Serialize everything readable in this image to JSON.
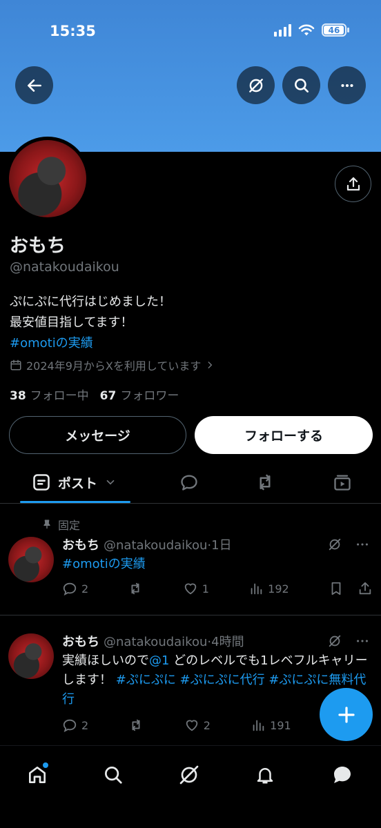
{
  "status_bar": {
    "time": "15:35",
    "battery": "46"
  },
  "header": {
    "back_icon": "arrow-left-icon",
    "grok_icon": "grok-icon",
    "search_icon": "search-icon",
    "more_icon": "more-icon"
  },
  "profile": {
    "name": "おもち",
    "handle": "@natakoudaikou",
    "bio_line1": "ぷにぷに代行はじめました！",
    "bio_line2": "最安値目指してます！",
    "bio_hashtag": "#omoti",
    "bio_hashtag_suffix": "の実績",
    "joined": "2024年9月からXを利用しています",
    "following_count": "38",
    "following_label": "フォロー中",
    "followers_count": "67",
    "followers_label": "フォロワー"
  },
  "buttons": {
    "message": "メッセージ",
    "follow": "フォローする"
  },
  "tabs": {
    "posts": "ポスト"
  },
  "posts": [
    {
      "pinned_label": "固定",
      "name": "おもち",
      "handle": "@natakoudaikou",
      "time": "·1日",
      "text_hashtag": "#omoti",
      "text_suffix": "の実績",
      "replies": "2",
      "likes": "1",
      "views": "192"
    },
    {
      "name": "おもち",
      "handle": "@natakoudaikou",
      "time": "·4時間",
      "text_part1": "実績ほしいので",
      "text_mention": "@1",
      "text_part2": " どのレベルでも1レベフルキャリーします！ ",
      "text_tags": "#ぷにぷに #ぷにぷに代行 #ぷにぷに無料代行",
      "replies": "2",
      "likes": "2",
      "views": "191"
    }
  ],
  "colors": {
    "accent": "#1d9bf0",
    "banner": "#4c9be8",
    "background": "#000000"
  }
}
